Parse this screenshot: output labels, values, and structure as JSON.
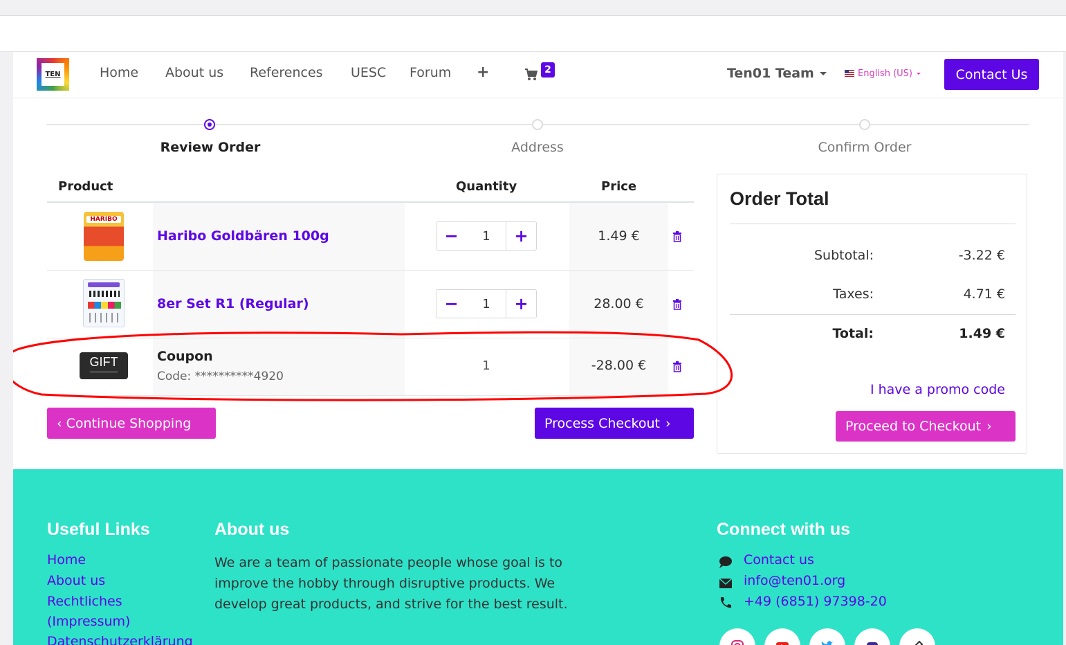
{
  "nav": {
    "logo_text": "TEN",
    "links": [
      "Home",
      "About us",
      "References",
      "UESC",
      "Forum"
    ],
    "cart_count": "2",
    "team": "Ten01 Team",
    "language": "English (US)",
    "contact_button": "Contact Us"
  },
  "steps": [
    "Review Order",
    "Address",
    "Confirm Order"
  ],
  "cart": {
    "headers": {
      "product": "Product",
      "quantity": "Quantity",
      "price": "Price"
    },
    "items": [
      {
        "name": "Haribo Goldbären 100g",
        "quantity": "1",
        "price": "1.49 €",
        "thumb_text": "HARIBO"
      },
      {
        "name": "8er Set R1 (Regular)",
        "quantity": "1",
        "price": "28.00 €"
      }
    ],
    "coupon": {
      "title": "Coupon",
      "code": "Code: **********4920",
      "quantity": "1",
      "price": "-28.00 €",
      "thumb_text": "GIFT"
    },
    "continue_button": "Continue Shopping",
    "process_button": "Process Checkout"
  },
  "order_total": {
    "title": "Order Total",
    "subtotal_label": "Subtotal:",
    "subtotal": "-3.22 €",
    "taxes_label": "Taxes:",
    "taxes": "4.71 €",
    "total_label": "Total:",
    "total": "1.49 €",
    "promo_link": "I have a promo code",
    "checkout_button": "Proceed to Checkout"
  },
  "footer": {
    "useful_title": "Useful Links",
    "useful_links": [
      "Home",
      "About us",
      "Rechtliches",
      "(Impressum)",
      "Datenschutzerklärung"
    ],
    "about_title": "About us",
    "about_text": "We are a team of passionate people whose goal is to improve the hobby through disruptive products. We develop great products, and strive for the best result.",
    "connect_title": "Connect with us",
    "contact_us": "Contact us",
    "email": "info@ten01.org",
    "phone": "+49 (6851) 97398-20"
  },
  "colors": {
    "primary": "#5d07e5",
    "pink": "#dc33c7",
    "footer": "#2ee2c8"
  }
}
